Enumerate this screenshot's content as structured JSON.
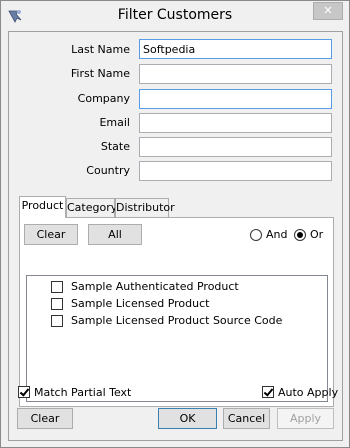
{
  "window": {
    "title": "Filter Customers",
    "close_glyph": "✕",
    "app_icon": "filter-customers-app-icon"
  },
  "fields": [
    {
      "label": "Last Name",
      "value": "Softpedia"
    },
    {
      "label": "First Name",
      "value": ""
    },
    {
      "label": "Company",
      "value": ""
    },
    {
      "label": "Email",
      "value": ""
    },
    {
      "label": "State",
      "value": ""
    },
    {
      "label": "Country",
      "value": ""
    }
  ],
  "tabs": [
    {
      "label": "Product",
      "active": true
    },
    {
      "label": "Category",
      "active": false
    },
    {
      "label": "Distributor",
      "active": false
    }
  ],
  "product_panel": {
    "clear_label": "Clear",
    "all_label": "All",
    "and_label": "And",
    "or_label": "Or",
    "selected_mode": "Or",
    "items": [
      {
        "label": "Sample Authenticated Product",
        "checked": false
      },
      {
        "label": "Sample Licensed Product",
        "checked": false
      },
      {
        "label": "Sample Licensed Product Source Code",
        "checked": false
      }
    ]
  },
  "options": {
    "match_partial_label": "Match Partial Text",
    "match_partial_checked": true,
    "auto_apply_label": "Auto Apply",
    "auto_apply_checked": true
  },
  "footer": {
    "clear_label": "Clear",
    "ok_label": "OK",
    "cancel_label": "Cancel",
    "apply_label": "Apply"
  },
  "colors": {
    "focus_border": "#569de5",
    "default_button_border": "#3c7fb1",
    "disabled_text": "#a0a0a0"
  }
}
